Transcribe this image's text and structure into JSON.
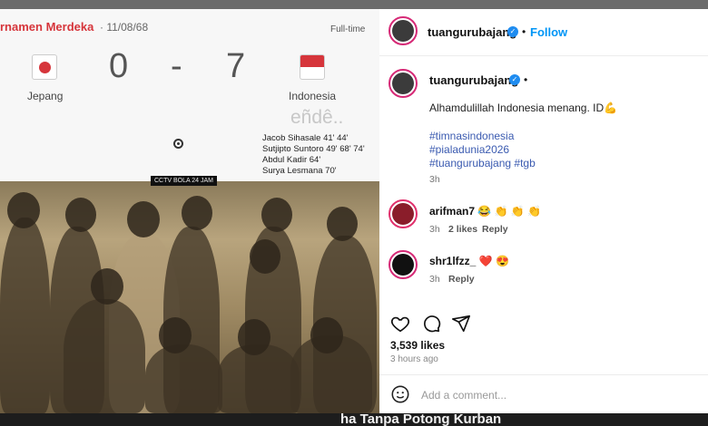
{
  "media": {
    "tournament": "rnamen Merdeka",
    "date": "· 11/08/68",
    "status": "Full-time",
    "home_score": "0",
    "score_sep": "-",
    "away_score": "7",
    "home_team": "Jepang",
    "away_team": "Indonesia",
    "watermark": "eñdê..",
    "scorers": [
      "Jacob Sihasale 41' 44'",
      "Sutjipto Suntoro 49' 68' 74'",
      "Abdul Kadir 64'",
      "Surya Lesmana 70'"
    ],
    "photo_tag": "CCTV BOLA 24 JAM"
  },
  "post": {
    "author": "tuangurubajang",
    "follow_label": "Follow",
    "sep": "•",
    "caption": "Alhamdulillah Indonesia menang. ID💪",
    "hashtags": [
      "#timnasindonesia",
      "#pialadunia2026",
      "#tuangurubajang #tgb"
    ],
    "caption_time": "3h",
    "comments": [
      {
        "user": "arifman7",
        "text": "😂 👏 👏 👏",
        "time": "3h",
        "likes": "2 likes",
        "reply": "Reply"
      },
      {
        "user": "shr1lfzz_",
        "text": "❤️ 😍",
        "time": "3h",
        "reply": "Reply"
      }
    ],
    "like_count": "3,539 likes",
    "posted_ago": "3 hours ago",
    "comment_placeholder": "Add a comment..."
  },
  "icons": {
    "like": "heart-icon",
    "comment": "comment-icon",
    "share": "share-icon",
    "emoji": "emoji-icon",
    "verified": "verified-icon"
  },
  "colors": {
    "accent": "#0095f6",
    "verified": "#1f8cf0",
    "hashtag": "#3a5ab0",
    "headline_red": "#d6353b"
  },
  "bottom": {
    "headline": "ha Tanpa Potong Kurban"
  }
}
